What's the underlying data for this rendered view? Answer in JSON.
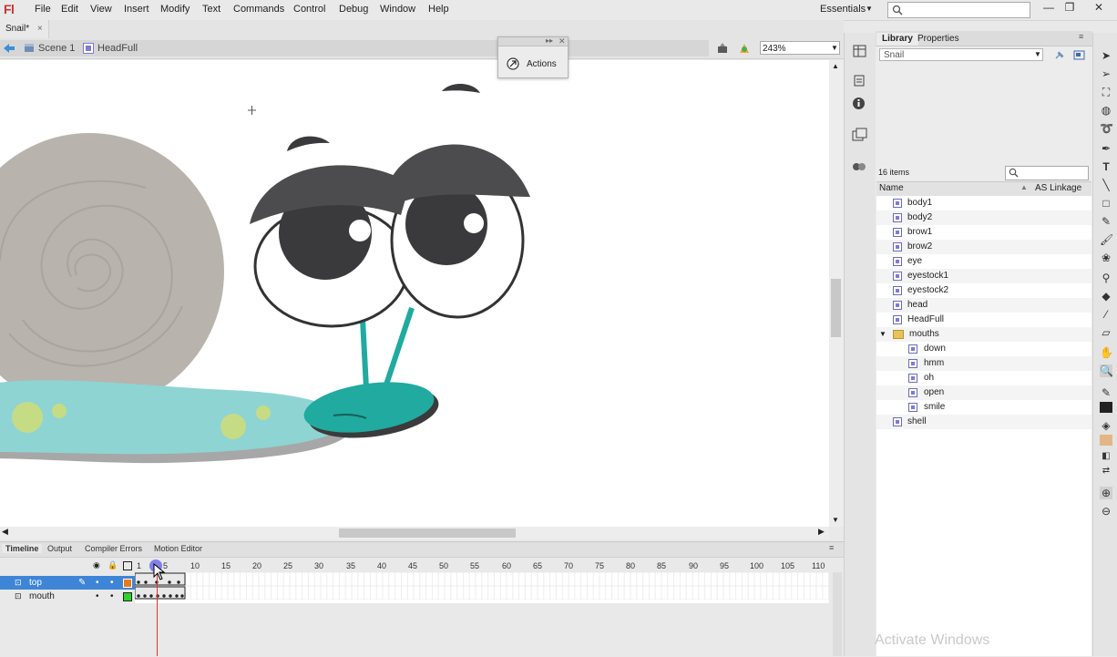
{
  "menubar": {
    "logo": "Fl",
    "items": [
      "File",
      "Edit",
      "View",
      "Insert",
      "Modify",
      "Text",
      "Commands",
      "Control",
      "Debug",
      "Window",
      "Help"
    ],
    "workspace": "Essentials"
  },
  "doc_tab": {
    "label": "Snail*",
    "close": "×"
  },
  "breadcrumb": {
    "scene": "Scene 1",
    "symbol": "HeadFull"
  },
  "zoom": "243%",
  "actions_panel": {
    "title": "Actions"
  },
  "library": {
    "tabs": [
      "Library",
      "Properties"
    ],
    "document": "Snail",
    "item_count": "16 items",
    "columns": {
      "name": "Name",
      "linkage": "AS Linkage"
    },
    "items": [
      {
        "label": "body1",
        "type": "symbol",
        "indent": 0
      },
      {
        "label": "body2",
        "type": "symbol",
        "indent": 0
      },
      {
        "label": "brow1",
        "type": "symbol",
        "indent": 0
      },
      {
        "label": "brow2",
        "type": "symbol",
        "indent": 0
      },
      {
        "label": "eye",
        "type": "symbol",
        "indent": 0
      },
      {
        "label": "eyestock1",
        "type": "symbol",
        "indent": 0
      },
      {
        "label": "eyestock2",
        "type": "symbol",
        "indent": 0
      },
      {
        "label": "head",
        "type": "symbol",
        "indent": 0
      },
      {
        "label": "HeadFull",
        "type": "symbol",
        "indent": 0
      },
      {
        "label": "mouths",
        "type": "folder",
        "indent": 0
      },
      {
        "label": "down",
        "type": "symbol",
        "indent": 1
      },
      {
        "label": "hmm",
        "type": "symbol",
        "indent": 1
      },
      {
        "label": "oh",
        "type": "symbol",
        "indent": 1
      },
      {
        "label": "open",
        "type": "symbol",
        "indent": 1
      },
      {
        "label": "smile",
        "type": "symbol",
        "indent": 1
      },
      {
        "label": "shell",
        "type": "symbol",
        "indent": 0
      }
    ]
  },
  "timeline": {
    "tabs": [
      "Timeline",
      "Output",
      "Compiler Errors",
      "Motion Editor"
    ],
    "ruler": [
      "1",
      "5",
      "10",
      "15",
      "20",
      "25",
      "30",
      "35",
      "40",
      "45",
      "50",
      "55",
      "60",
      "65",
      "70",
      "75",
      "80",
      "85",
      "90",
      "95",
      "100",
      "105",
      "110"
    ],
    "layers": [
      {
        "name": "top",
        "selected": true,
        "color": "#e87a1a"
      },
      {
        "name": "mouth",
        "selected": false,
        "color": "#2bd42b"
      }
    ]
  },
  "watermark": "Activate Windows",
  "colors": {
    "stage": "#ffffff",
    "shell": "#b7b2ac",
    "body": "#85d3d2",
    "mouth": "#20aaa0",
    "brow": "#4c4c4e",
    "pupil": "#3a3a3c"
  }
}
